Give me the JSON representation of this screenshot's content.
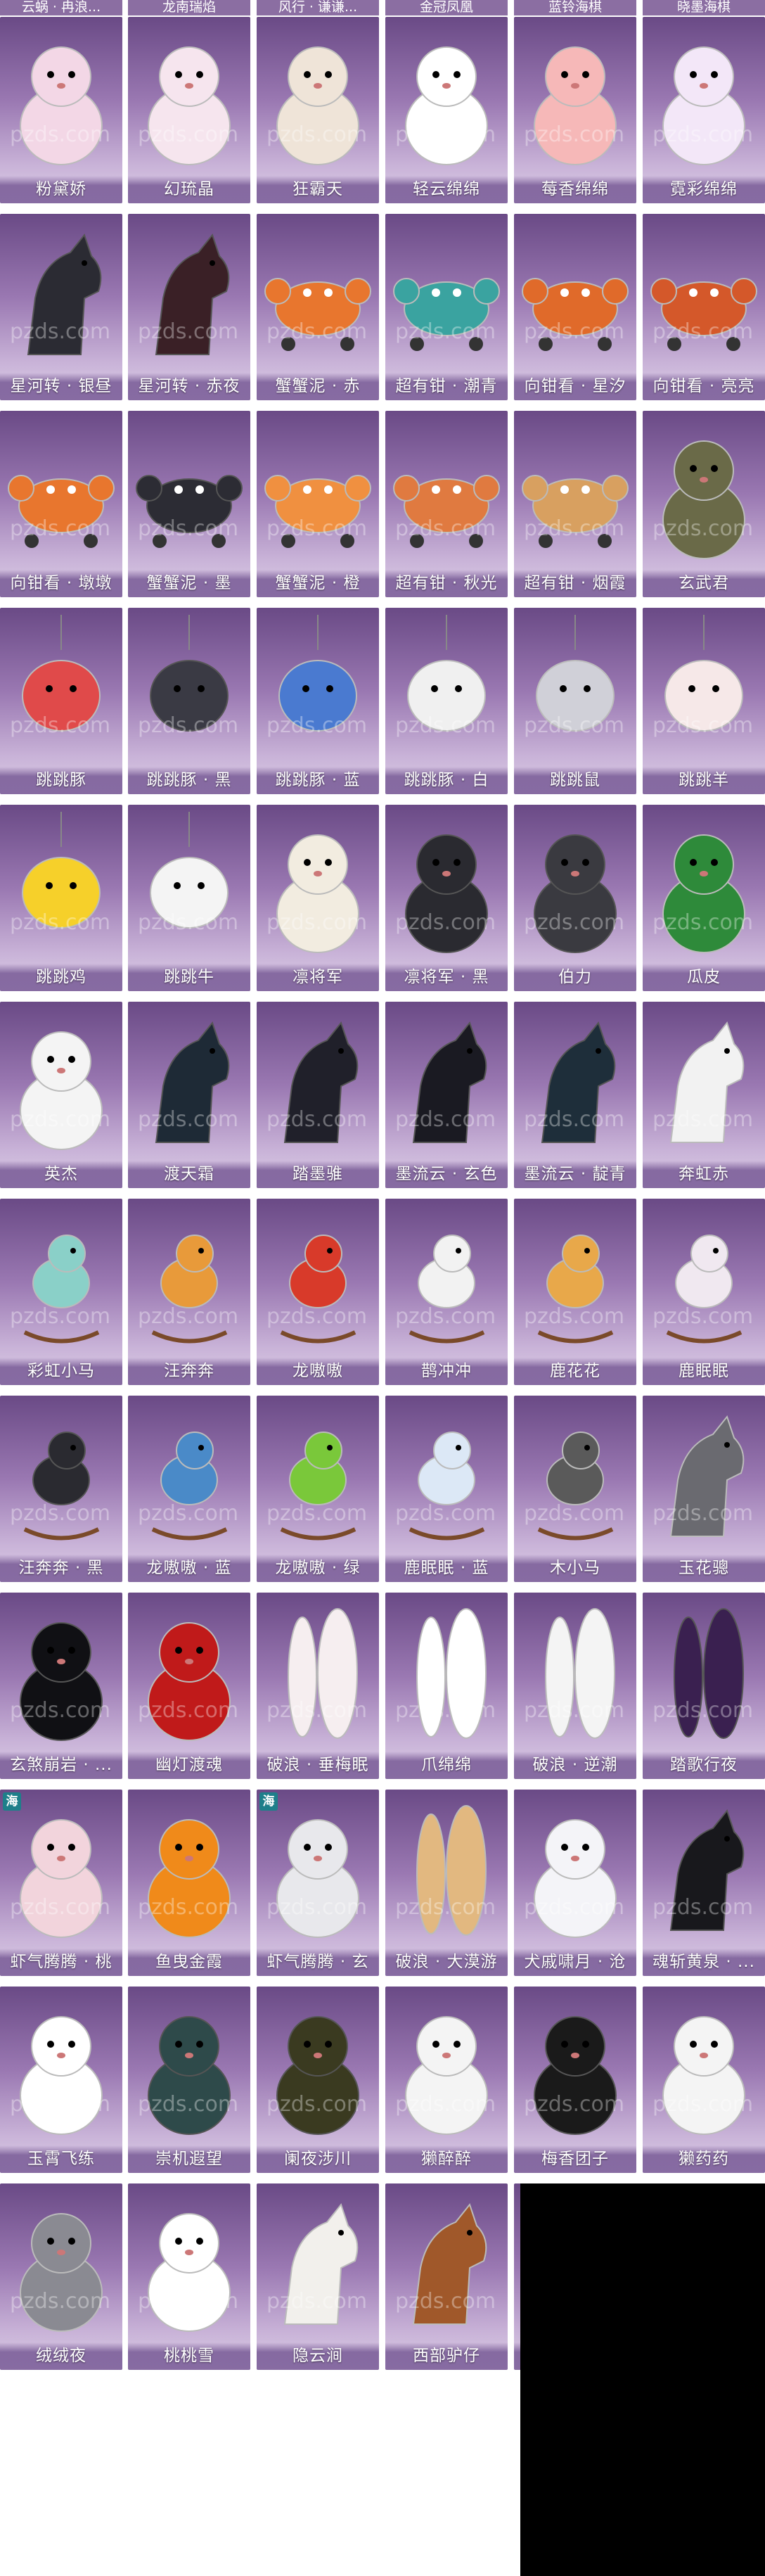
{
  "top_row": [
    "云蜗 · 冉浪...",
    "龙南瑞焰",
    "风行 · 谦谦...",
    "金冠凤凰",
    "蓝铃海棋",
    "晓墨海棋"
  ],
  "watermark": "pzds.com",
  "colors": {
    "panel_top": "#6a4a86",
    "panel_bottom": "#dccfe6",
    "badge_teal": "#1e7f8a"
  },
  "items": [
    {
      "name": "粉黛娇",
      "icon": "alpaca-pink",
      "color": "#f3d7e6"
    },
    {
      "name": "幻琉晶",
      "icon": "alpaca-pink",
      "color": "#f6e5ee"
    },
    {
      "name": "狂霸天",
      "icon": "alpaca-scarf",
      "color": "#efe4d8"
    },
    {
      "name": "轻云绵绵",
      "icon": "alpaca-fluffy",
      "color": "#ffffff"
    },
    {
      "name": "莓香绵绵",
      "icon": "alpaca-strawberry",
      "color": "#f6b8b8"
    },
    {
      "name": "霓彩绵绵",
      "icon": "alpaca-rainbow",
      "color": "#f3e7f8"
    },
    {
      "name": "星河转 · 银昼",
      "icon": "horse-dark",
      "color": "#2b2b33"
    },
    {
      "name": "星河转 · 赤夜",
      "icon": "horse-dark",
      "color": "#3a2026"
    },
    {
      "name": "蟹蟹泥 · 赤",
      "icon": "crab",
      "color": "#e8762e"
    },
    {
      "name": "超有钳 · 潮青",
      "icon": "crab-cart",
      "color": "#3aa3a0"
    },
    {
      "name": "向钳看 · 星汐",
      "icon": "crab",
      "color": "#e06a2a"
    },
    {
      "name": "向钳看 · 亮亮",
      "icon": "crab",
      "color": "#d4582a"
    },
    {
      "name": "向钳看 · 墩墩",
      "icon": "crab-cart",
      "color": "#e8762e"
    },
    {
      "name": "蟹蟹泥 · 墨",
      "icon": "crab",
      "color": "#2c2c34"
    },
    {
      "name": "蟹蟹泥 · 橙",
      "icon": "crab",
      "color": "#f09040"
    },
    {
      "name": "超有钳 · 秋光",
      "icon": "crab-cart",
      "color": "#e07a40"
    },
    {
      "name": "超有钳 · 烟霞",
      "icon": "crab-cart",
      "color": "#d8a060"
    },
    {
      "name": "玄武君",
      "icon": "turtle",
      "color": "#6a6a48"
    },
    {
      "name": "跳跳豚",
      "icon": "dolphin",
      "color": "#e04a4a"
    },
    {
      "name": "跳跳豚 · 黑",
      "icon": "dolphin",
      "color": "#3a3a44"
    },
    {
      "name": "跳跳豚 · 蓝",
      "icon": "dolphin",
      "color": "#4a7ad0"
    },
    {
      "name": "跳跳豚 · 白",
      "icon": "dolphin",
      "color": "#f0f0f0"
    },
    {
      "name": "跳跳鼠",
      "icon": "mouse-balloon",
      "color": "#d0d0d8"
    },
    {
      "name": "跳跳羊",
      "icon": "sheep-balloon",
      "color": "#f6e8e8"
    },
    {
      "name": "跳跳鸡",
      "icon": "chick-balloon",
      "color": "#f6d02a"
    },
    {
      "name": "跳跳牛",
      "icon": "cow-balloon",
      "color": "#f4f4f4"
    },
    {
      "name": "凛将军",
      "icon": "goose-carriage",
      "color": "#f2ece0"
    },
    {
      "name": "凛将军 · 黑",
      "icon": "goose-black",
      "color": "#2a2a30"
    },
    {
      "name": "伯力",
      "icon": "husky",
      "color": "#3a3a40"
    },
    {
      "name": "瓜皮",
      "icon": "watermelon-dog",
      "color": "#2e8a3a"
    },
    {
      "name": "英杰",
      "icon": "white-dog",
      "color": "#f4f4f4"
    },
    {
      "name": "渡天霜",
      "icon": "horse-dark",
      "color": "#1e2a36"
    },
    {
      "name": "踏墨骓",
      "icon": "horse-dark",
      "color": "#20202a"
    },
    {
      "name": "墨流云 · 玄色",
      "icon": "horse-dark",
      "color": "#1a1a22"
    },
    {
      "name": "墨流云 · 靛青",
      "icon": "horse-dark",
      "color": "#1e2e3a"
    },
    {
      "name": "奔虹赤",
      "icon": "horse-white",
      "color": "#f2f2f2"
    },
    {
      "name": "彩虹小马",
      "icon": "rocking-horse",
      "color": "#8ad0c8"
    },
    {
      "name": "汪奔奔",
      "icon": "rocking-dog",
      "color": "#e89a3a"
    },
    {
      "name": "龙嗷嗷",
      "icon": "rocking-dragon",
      "color": "#d83a2a"
    },
    {
      "name": "鹊冲冲",
      "icon": "rocking-magpie",
      "color": "#f2f2f2"
    },
    {
      "name": "鹿花花",
      "icon": "rocking-deer",
      "color": "#e8a84a"
    },
    {
      "name": "鹿眠眠",
      "icon": "rocking-deer",
      "color": "#f0e8f0"
    },
    {
      "name": "汪奔奔 · 黑",
      "icon": "rocking-dog",
      "color": "#2a2a30"
    },
    {
      "name": "龙嗷嗷 · 蓝",
      "icon": "rocking-dragon",
      "color": "#4a8ac8"
    },
    {
      "name": "龙嗷嗷 · 绿",
      "icon": "rocking-dragon",
      "color": "#7ac83a"
    },
    {
      "name": "鹿眠眠 · 蓝",
      "icon": "rocking-deer",
      "color": "#dce8f6"
    },
    {
      "name": "木小马",
      "icon": "rocking-donkey",
      "color": "#5a5a5a"
    },
    {
      "name": "玉花骢",
      "icon": "horse-grey",
      "color": "#6a6a70"
    },
    {
      "name": "玄煞崩岩 · ...",
      "icon": "black-bull",
      "color": "#101014"
    },
    {
      "name": "幽灯渡魂",
      "icon": "red-lantern",
      "color": "#c01a1a"
    },
    {
      "name": "破浪 · 垂梅眠",
      "icon": "surfboard",
      "color": "#f6eef0"
    },
    {
      "name": "爪绵绵",
      "icon": "paw-board",
      "color": "#ffffff"
    },
    {
      "name": "破浪 · 逆潮",
      "icon": "surfboard",
      "color": "#f4f4f4"
    },
    {
      "name": "踏歌行夜",
      "icon": "dark-board",
      "color": "#3a2050"
    },
    {
      "name": "虾气腾腾 · 桃",
      "icon": "shrimp-rabbit",
      "color": "#f2d4dc"
    },
    {
      "name": "鱼曳金霞",
      "icon": "goldfish",
      "color": "#f08a1a"
    },
    {
      "name": "虾气腾腾 · 玄",
      "icon": "shrimp-rabbit",
      "color": "#e8e8ec"
    },
    {
      "name": "破浪 · 大漠游",
      "icon": "surfboard",
      "color": "#e2b880"
    },
    {
      "name": "犬戚啸月 · 沧",
      "icon": "white-wolf",
      "color": "#f4f4f8"
    },
    {
      "name": "魂斩黄泉 · ...",
      "icon": "black-horse",
      "color": "#18181c"
    },
    {
      "name": "玉霄飞练",
      "icon": "white-cat",
      "color": "#ffffff"
    },
    {
      "name": "崇机遐望",
      "icon": "mech",
      "color": "#2e4a4a"
    },
    {
      "name": "阑夜涉川",
      "icon": "mech-dark",
      "color": "#3a3a20"
    },
    {
      "name": "獭醉醉",
      "icon": "otter-hat",
      "color": "#f4f4f4"
    },
    {
      "name": "梅香团子",
      "icon": "panda",
      "color": "#1a1a1a"
    },
    {
      "name": "獭药药",
      "icon": "polar-bear",
      "color": "#f4f4f4"
    },
    {
      "name": "绒绒夜",
      "icon": "grey-rabbit",
      "color": "#8a8a92"
    },
    {
      "name": "桃桃雪",
      "icon": "white-fluffy",
      "color": "#ffffff"
    },
    {
      "name": "隐云涧",
      "icon": "donkey-white",
      "color": "#f2f0ec"
    },
    {
      "name": "西部驴仔",
      "icon": "donkey-hat",
      "color": "#a0582a"
    },
    {
      "name": "玉霄飞练",
      "icon": "white-cat",
      "color": "#ffffff"
    }
  ],
  "badges": [
    {
      "index": 54,
      "text": "海"
    },
    {
      "index": 56,
      "text": "海"
    }
  ]
}
